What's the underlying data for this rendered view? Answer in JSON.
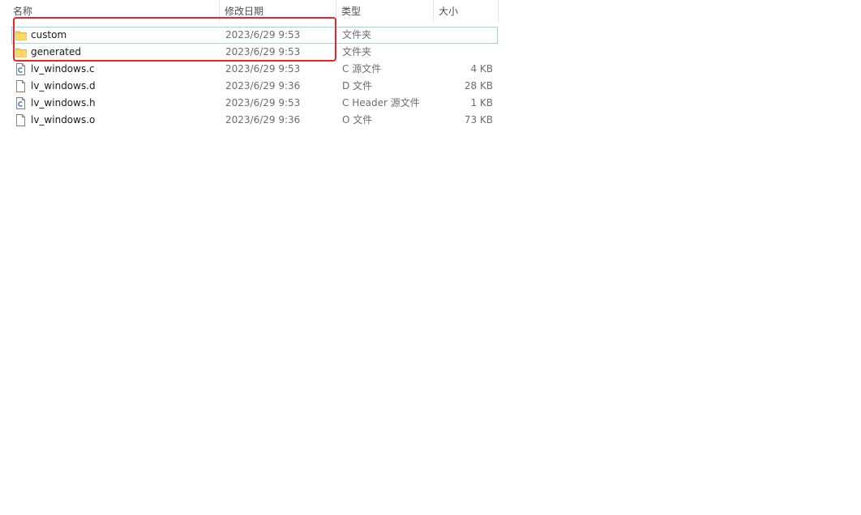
{
  "header": {
    "name_label": "名称",
    "date_label": "修改日期",
    "type_label": "类型",
    "size_label": "大小",
    "sort_indicator": "^"
  },
  "files": [
    {
      "name": "custom",
      "date": "2023/6/29 9:53",
      "type": "文件夹",
      "size": "",
      "icon": "folder-icon",
      "selected": true
    },
    {
      "name": "generated",
      "date": "2023/6/29 9:53",
      "type": "文件夹",
      "size": "",
      "icon": "folder-icon",
      "selected": false
    },
    {
      "name": "lv_windows.c",
      "date": "2023/6/29 9:53",
      "type": "C 源文件",
      "size": "4 KB",
      "icon": "c-source-file-icon",
      "selected": false
    },
    {
      "name": "lv_windows.d",
      "date": "2023/6/29 9:36",
      "type": "D 文件",
      "size": "28 KB",
      "icon": "generic-file-icon",
      "selected": false
    },
    {
      "name": "lv_windows.h",
      "date": "2023/6/29 9:53",
      "type": "C Header 源文件",
      "size": "1 KB",
      "icon": "c-header-file-icon",
      "selected": false
    },
    {
      "name": "lv_windows.o",
      "date": "2023/6/29 9:36",
      "type": "O 文件",
      "size": "73 KB",
      "icon": "generic-file-icon",
      "selected": false
    }
  ],
  "colors": {
    "annotation": "#e8262b",
    "selection_border": "#99d1ff",
    "folder": "#f5c84c",
    "c_file_accent": "#2a6fb4"
  }
}
